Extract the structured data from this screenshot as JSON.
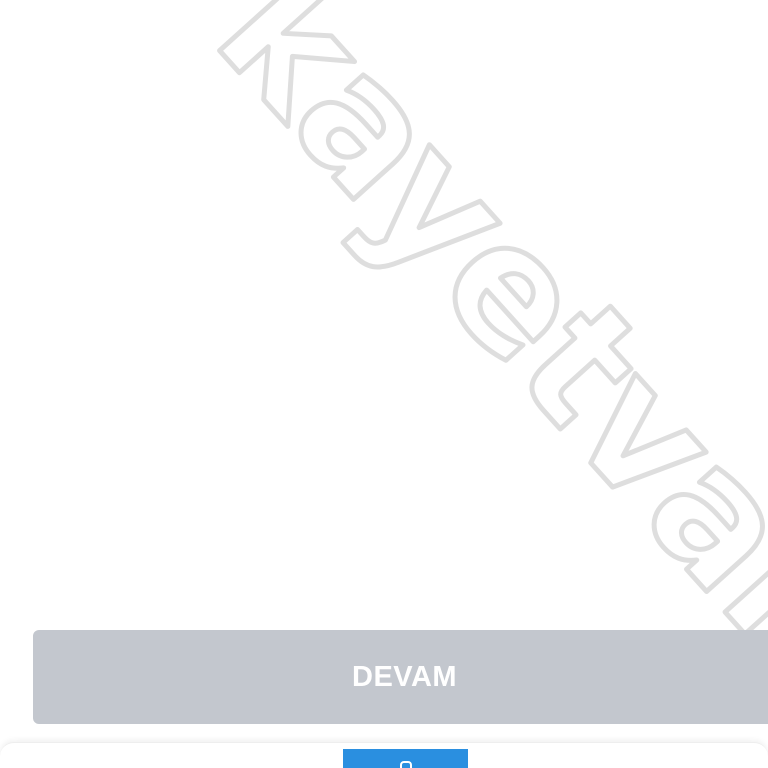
{
  "watermark": {
    "text": "kayetvar"
  },
  "continue_button": {
    "label": "DEVAM"
  },
  "bottom_nav": {
    "active_tab_icon": "user-icon"
  },
  "colors": {
    "button_disabled_bg": "#c3c7ce",
    "button_text": "#ffffff",
    "watermark_stroke": "#dedede",
    "active_tab_bg": "#2a8fe0"
  }
}
